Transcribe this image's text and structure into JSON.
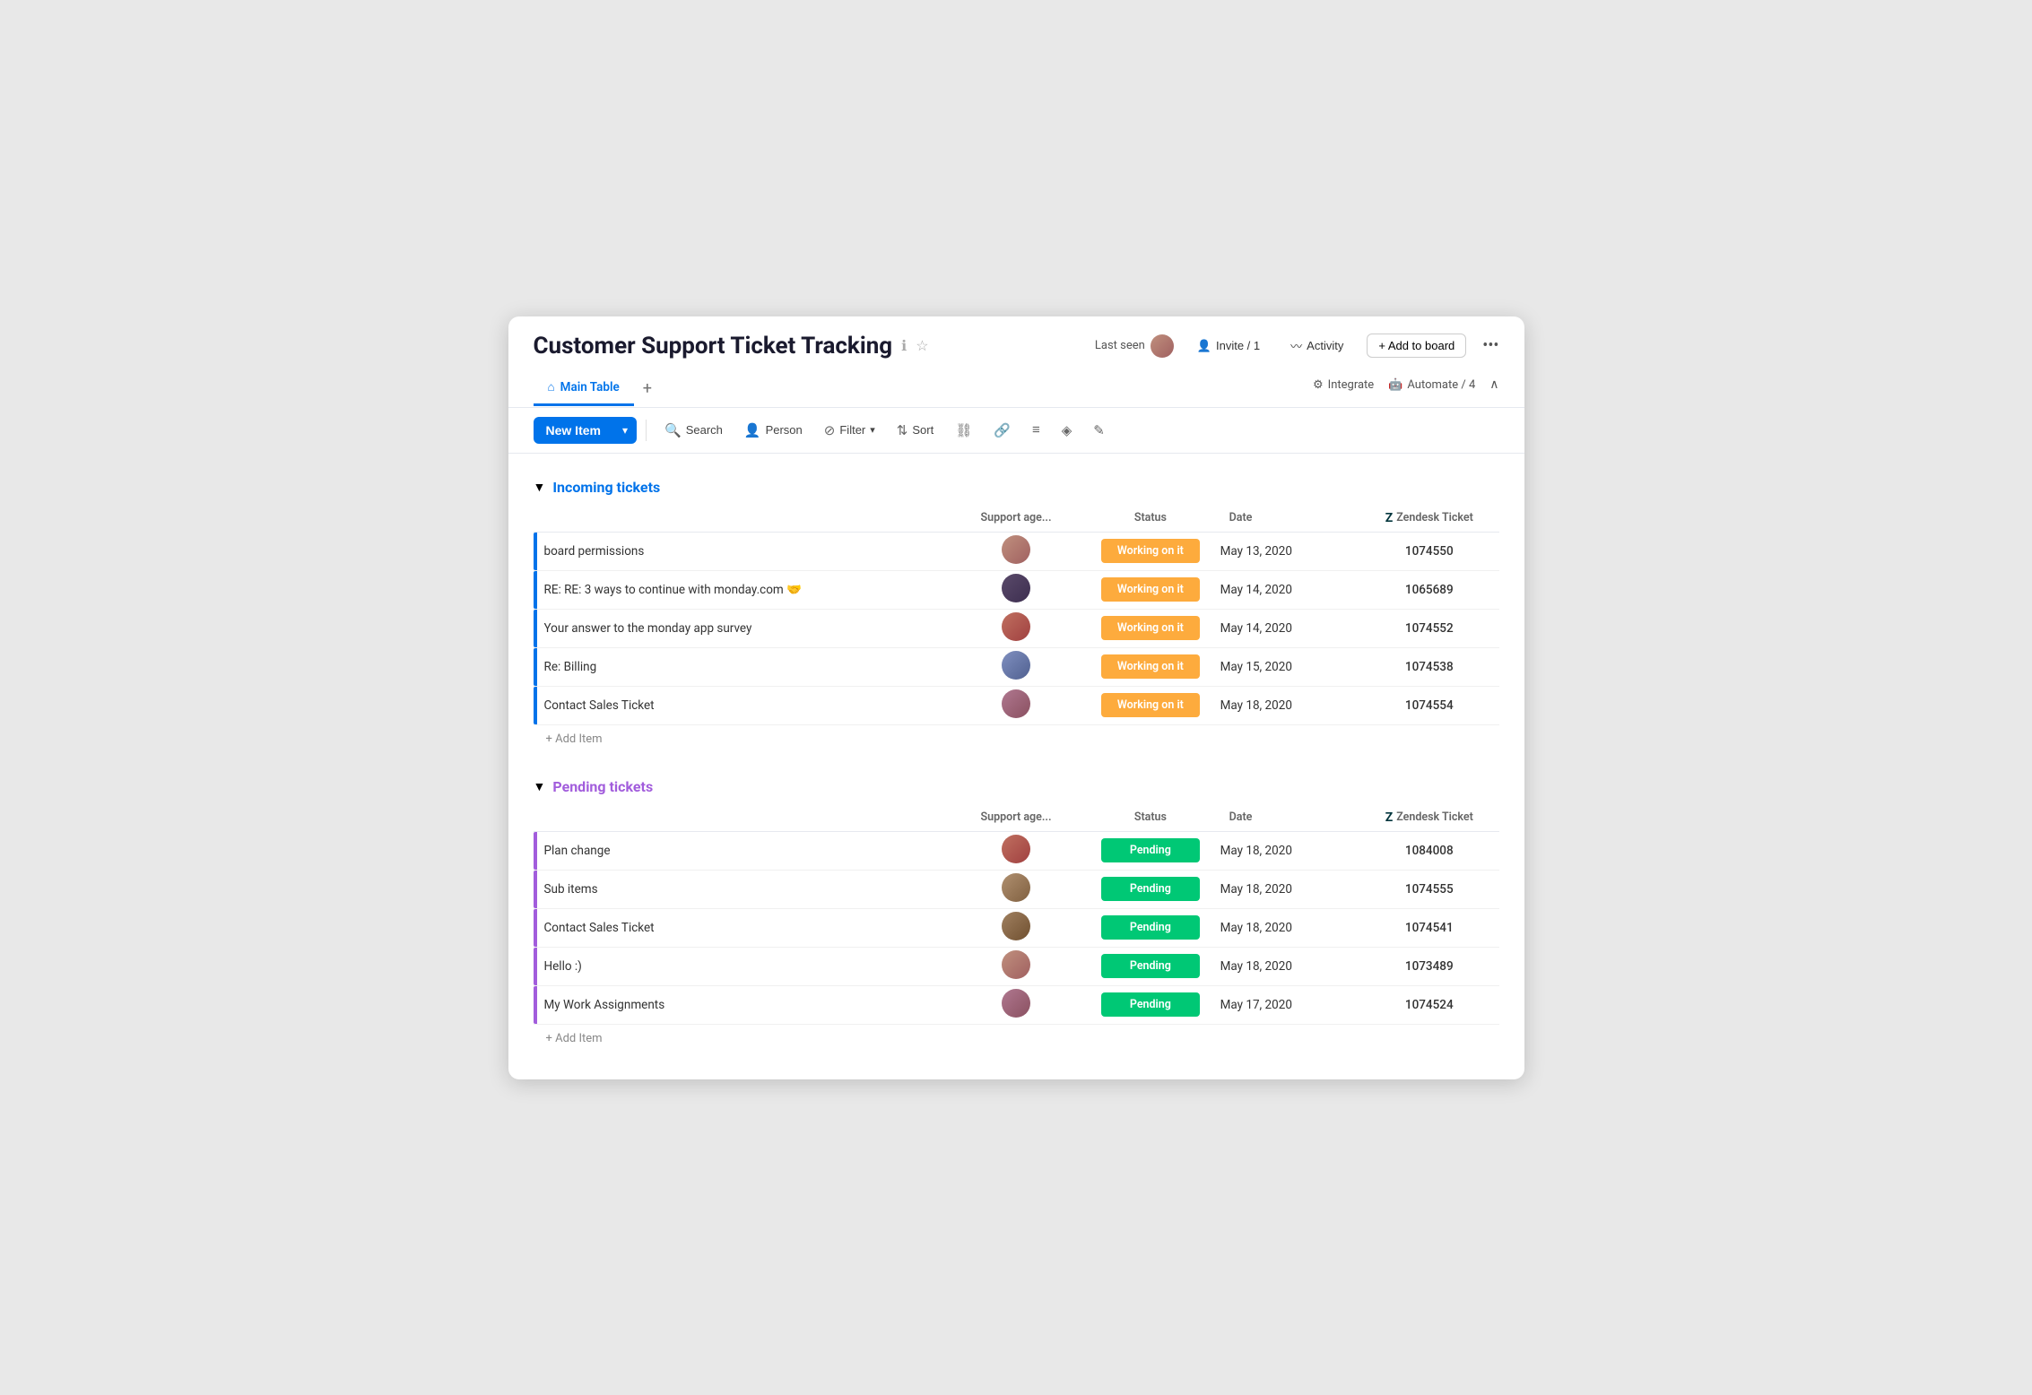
{
  "header": {
    "title": "Customer Support Ticket Tracking",
    "info_icon": "ℹ",
    "star_icon": "☆",
    "last_seen_label": "Last seen",
    "invite_label": "Invite / 1",
    "activity_label": "Activity",
    "add_to_board_label": "+ Add to board",
    "more_icon": "•••"
  },
  "tabs": {
    "main_table_label": "Main Table",
    "add_icon": "+",
    "integrate_label": "Integrate",
    "automate_label": "Automate / 4",
    "collapse_icon": "∧"
  },
  "toolbar": {
    "new_item_label": "New Item",
    "new_item_dropdown_icon": "▾",
    "search_label": "Search",
    "person_label": "Person",
    "filter_label": "Filter",
    "filter_dropdown": "▾",
    "sort_label": "Sort",
    "group_by_icon": "⊕",
    "link_icon": "🔗",
    "row_height_icon": "≡",
    "color_icon": "⬟",
    "edit_icon": "✎"
  },
  "incoming": {
    "title": "Incoming tickets",
    "chevron": "▼",
    "col_name": "",
    "col_agent": "Support age...",
    "col_status": "Status",
    "col_date": "Date",
    "col_zendesk": "Zendesk Ticket",
    "rows": [
      {
        "name": "board permissions",
        "status": "Working on it",
        "status_class": "status-working",
        "date": "May 13, 2020",
        "zendesk": "1074550",
        "avatar_class": "av1"
      },
      {
        "name": "RE: RE: 3 ways to continue with monday.com 🤝",
        "status": "Working on it",
        "status_class": "status-working",
        "date": "May 14, 2020",
        "zendesk": "1065689",
        "avatar_class": "av2"
      },
      {
        "name": "Your answer to the monday app survey",
        "status": "Working on it",
        "status_class": "status-working",
        "date": "May 14, 2020",
        "zendesk": "1074552",
        "avatar_class": "av3"
      },
      {
        "name": "Re: Billing",
        "status": "Working on it",
        "status_class": "status-working",
        "date": "May 15, 2020",
        "zendesk": "1074538",
        "avatar_class": "av4"
      },
      {
        "name": "Contact Sales Ticket",
        "status": "Working on it",
        "status_class": "status-working",
        "date": "May 18, 2020",
        "zendesk": "1074554",
        "avatar_class": "av5"
      }
    ],
    "add_item_label": "+ Add Item"
  },
  "pending": {
    "title": "Pending tickets",
    "chevron": "▼",
    "col_name": "",
    "col_agent": "Support age...",
    "col_status": "Status",
    "col_date": "Date",
    "col_zendesk": "Zendesk Ticket",
    "rows": [
      {
        "name": "Plan change",
        "status": "Pending",
        "status_class": "status-pending",
        "date": "May 18, 2020",
        "zendesk": "1084008",
        "avatar_class": "av3"
      },
      {
        "name": "Sub items",
        "status": "Pending",
        "status_class": "status-pending",
        "date": "May 18, 2020",
        "zendesk": "1074555",
        "avatar_class": "av9"
      },
      {
        "name": "Contact Sales Ticket",
        "status": "Pending",
        "status_class": "status-pending",
        "date": "May 18, 2020",
        "zendesk": "1074541",
        "avatar_class": "av8"
      },
      {
        "name": "Hello :)",
        "status": "Pending",
        "status_class": "status-pending",
        "date": "May 18, 2020",
        "zendesk": "1073489",
        "avatar_class": "av1"
      },
      {
        "name": "My Work Assignments",
        "status": "Pending",
        "status_class": "status-pending",
        "date": "May 17, 2020",
        "zendesk": "1074524",
        "avatar_class": "av5"
      }
    ],
    "add_item_label": "+ Add Item"
  }
}
